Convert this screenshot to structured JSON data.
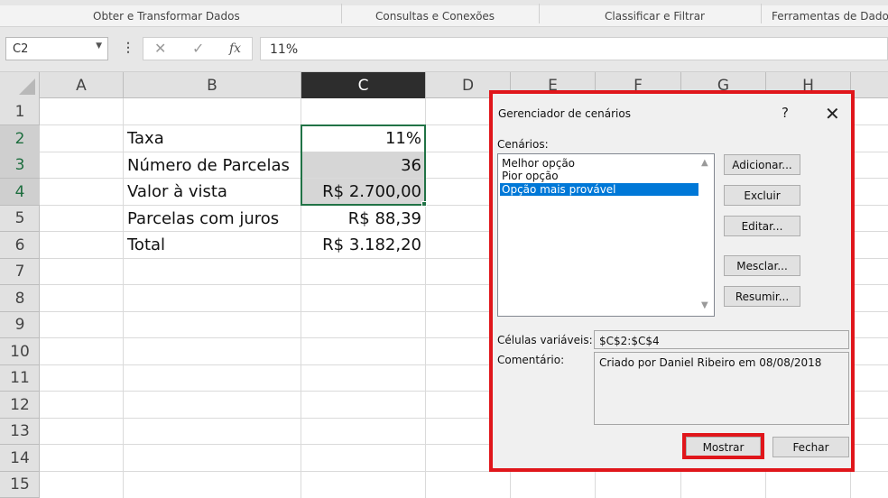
{
  "ribbon": {
    "groups": [
      "Obter e Transformar Dados",
      "Consultas e Conexões",
      "Classificar e Filtrar",
      "Ferramentas de Dados"
    ]
  },
  "formula_bar": {
    "name_box": "C2",
    "cancel_glyph": "✕",
    "enter_glyph": "✓",
    "fx_label": "fx",
    "value": "11%"
  },
  "columns": [
    "A",
    "B",
    "C",
    "D",
    "E",
    "F",
    "G",
    "H"
  ],
  "selected_column": "C",
  "rows": [
    "1",
    "2",
    "3",
    "4",
    "5",
    "6",
    "7",
    "8",
    "9",
    "10",
    "11",
    "12",
    "13",
    "14",
    "15"
  ],
  "sheet": {
    "labels": [
      "Taxa",
      "Número de Parcelas",
      "Valor à vista",
      "Parcelas com juros",
      "Total"
    ],
    "values": [
      "11%",
      "36",
      "R$ 2.700,00",
      "R$ 88,39",
      "R$ 3.182,20"
    ]
  },
  "dialog": {
    "title": "Gerenciador de cenários",
    "help": "?",
    "close": "✕",
    "scenarios_label": "Cenários:",
    "scenarios": [
      "Melhor opção",
      "Pior opção",
      "Opção mais provável"
    ],
    "selected_scenario": "Opção mais provável",
    "buttons": {
      "add": "Adicionar...",
      "delete": "Excluir",
      "edit": "Editar...",
      "merge": "Mesclar...",
      "summary": "Resumir...",
      "show": "Mostrar",
      "close": "Fechar"
    },
    "changing_cells_label": "Células variáveis:",
    "changing_cells": "$C$2:$C$4",
    "comment_label": "Comentário:",
    "comment": "Criado por Daniel Ribeiro em 08/08/2018"
  },
  "colors": {
    "excel_green": "#217346",
    "highlight_red": "#e0161b",
    "selection_blue": "#0078d7"
  }
}
